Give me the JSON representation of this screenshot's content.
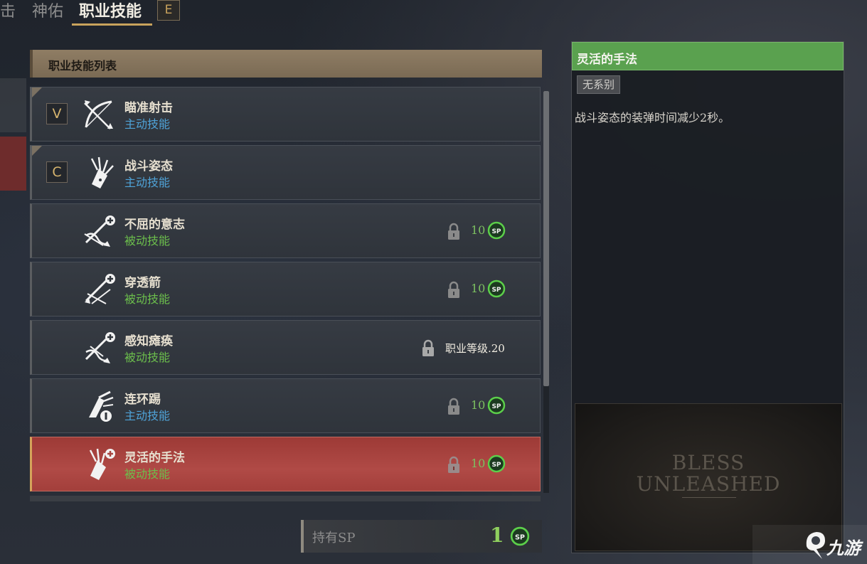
{
  "tabs": [
    {
      "label": "击"
    },
    {
      "label": "神佑"
    },
    {
      "label": "职业技能",
      "active": true
    }
  ],
  "tab_hotkey": "E",
  "list": {
    "header": "职业技能列表",
    "rows": [
      {
        "name": "瞄准射击",
        "type": "主动技能",
        "kind": "active",
        "hotkey": "V",
        "icon": "bow-arrows-icon"
      },
      {
        "name": "战斗姿态",
        "type": "主动技能",
        "kind": "active",
        "hotkey": "C",
        "icon": "quiver-icon"
      },
      {
        "name": "不屈的意志",
        "type": "被动技能",
        "kind": "passive",
        "cost": "10",
        "icon": "arrows-plus-icon"
      },
      {
        "name": "穿透箭",
        "type": "被动技能",
        "kind": "passive",
        "cost": "10",
        "icon": "arrows-plus-icon"
      },
      {
        "name": "感知瘫痪",
        "type": "被动技能",
        "kind": "passive",
        "requirement": "职业等级.20",
        "icon": "arrows-plus-icon"
      },
      {
        "name": "连环踢",
        "type": "主动技能",
        "kind": "active",
        "cost": "10",
        "icon": "kick-icon"
      },
      {
        "name": "灵活的手法",
        "type": "被动技能",
        "kind": "passive",
        "cost": "10",
        "icon": "quiver-plus-icon",
        "selected": true
      }
    ]
  },
  "sp": {
    "label": "持有SP",
    "value": "1",
    "badge": "SP"
  },
  "detail": {
    "title": "灵活的手法",
    "tag": "无系别",
    "description": "战斗姿态的装弹时间减少2秒。",
    "banner_logo_line1": "BLESS",
    "banner_logo_line2": "UNLEASHED"
  },
  "watermark": {
    "text": "九游"
  },
  "colors": {
    "accent_gold": "#c9a35c",
    "active_skill": "#4fa3d8",
    "passive_skill": "#6cbf4c",
    "selected_row": "#a33f3b",
    "detail_title": "#5aa14f",
    "sp_green": "#8fcf5e"
  }
}
